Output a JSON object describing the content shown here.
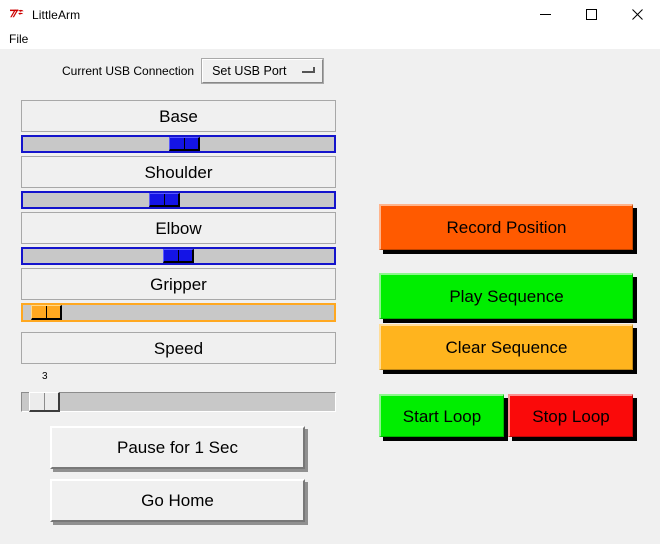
{
  "window": {
    "title": "LittleArm",
    "icon": "tkinter-feather-icon",
    "controls": {
      "minimize": "minimize-icon",
      "maximize": "maximize-icon",
      "close": "close-icon"
    }
  },
  "menubar": {
    "items": [
      {
        "label": "File"
      }
    ]
  },
  "usb": {
    "label": "Current USB Connection",
    "option_selected": "Set USB Port",
    "indicator": "optionmenu-indicator-icon"
  },
  "joints": [
    {
      "name": "Base",
      "label": "Base",
      "value_percent": 52,
      "accent": "#1414e6",
      "border": "#1414cc"
    },
    {
      "name": "Shoulder",
      "label": "Shoulder",
      "value_percent": 45,
      "accent": "#1414e6",
      "border": "#1414cc"
    },
    {
      "name": "Elbow",
      "label": "Elbow",
      "value_percent": 50,
      "accent": "#1414e6",
      "border": "#1414cc"
    },
    {
      "name": "Gripper",
      "label": "Gripper",
      "value_percent": 3,
      "accent": "#ffa820",
      "border": "#ffa820"
    }
  ],
  "speed": {
    "label": "Speed",
    "value": "3",
    "value_percent": 3
  },
  "left_buttons": [
    {
      "label": "Pause for 1 Sec"
    },
    {
      "label": "Go Home"
    }
  ],
  "actions": {
    "record": {
      "label": "Record Position",
      "color": "#ff5a00"
    },
    "play": {
      "label": "Play Sequence",
      "color": "#00ee00"
    },
    "clear": {
      "label": "Clear Sequence",
      "color": "#ffb41e"
    },
    "start_loop": {
      "label": "Start Loop",
      "color": "#00ee00"
    },
    "stop_loop": {
      "label": "Stop Loop",
      "color": "#fa0a0a"
    }
  },
  "colors": {
    "window_background": "#f0f0f0",
    "titlebar_background": "#ffffff",
    "slider_trough": "#c8c8c8",
    "text": "#000000"
  }
}
